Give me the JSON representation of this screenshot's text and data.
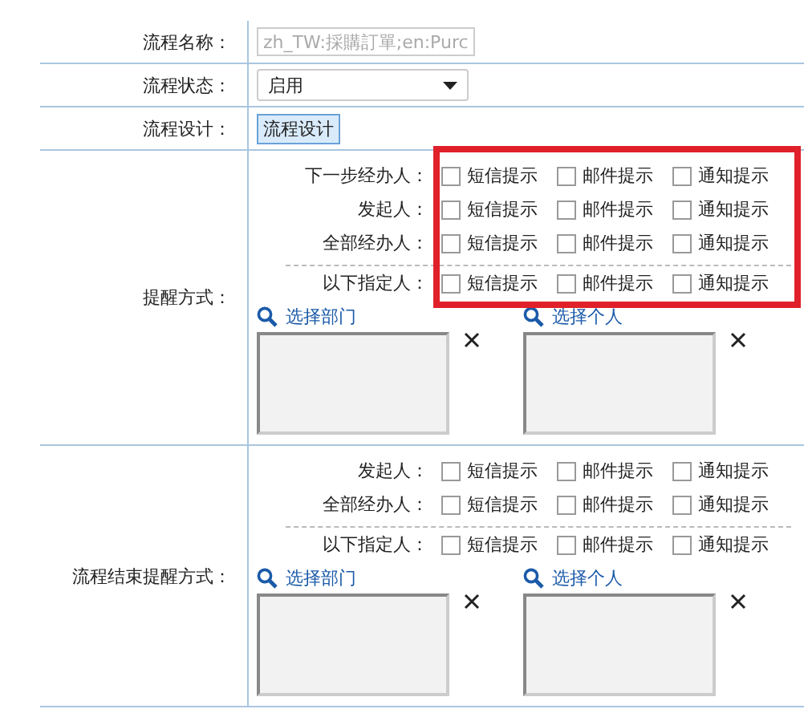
{
  "form": {
    "rows": [
      {
        "kind": "text",
        "label": "流程名称：",
        "value": "zh_TW:採購訂單;en:Purc"
      },
      {
        "kind": "select",
        "label": "流程状态：",
        "value": "启用"
      },
      {
        "kind": "button",
        "label": "流程设计：",
        "value": "流程设计"
      }
    ],
    "sections": [
      {
        "label": "提醒方式：",
        "highlighted": true,
        "recipients": [
          {
            "kind": "plain",
            "label": "下一步经办人：",
            "options": [
              {
                "label": "短信提示",
                "checked": false
              },
              {
                "label": "邮件提示",
                "checked": false
              },
              {
                "label": "通知提示",
                "checked": false
              }
            ]
          },
          {
            "kind": "plain",
            "label": "发起人：",
            "options": [
              {
                "label": "短信提示",
                "checked": false
              },
              {
                "label": "邮件提示",
                "checked": false
              },
              {
                "label": "通知提示",
                "checked": false
              }
            ]
          },
          {
            "kind": "plain",
            "label": "全部经办人：",
            "options": [
              {
                "label": "短信提示",
                "checked": false
              },
              {
                "label": "邮件提示",
                "checked": false
              },
              {
                "label": "通知提示",
                "checked": false
              }
            ]
          },
          {
            "kind": "specified",
            "label": "以下指定人：",
            "options": [
              {
                "label": "短信提示",
                "checked": false
              },
              {
                "label": "邮件提示",
                "checked": false
              },
              {
                "label": "通知提示",
                "checked": false
              }
            ]
          }
        ],
        "pickers": [
          {
            "label": "选择部门"
          },
          {
            "label": "选择个人"
          }
        ]
      },
      {
        "label": "流程结束提醒方式：",
        "highlighted": false,
        "recipients": [
          {
            "kind": "plain",
            "label": "发起人：",
            "options": [
              {
                "label": "短信提示",
                "checked": false
              },
              {
                "label": "邮件提示",
                "checked": false
              },
              {
                "label": "通知提示",
                "checked": false
              }
            ]
          },
          {
            "kind": "plain",
            "label": "全部经办人：",
            "options": [
              {
                "label": "短信提示",
                "checked": false
              },
              {
                "label": "邮件提示",
                "checked": false
              },
              {
                "label": "通知提示",
                "checked": false
              }
            ]
          },
          {
            "kind": "specified",
            "label": "以下指定人：",
            "options": [
              {
                "label": "短信提示",
                "checked": false
              },
              {
                "label": "邮件提示",
                "checked": false
              },
              {
                "label": "通知提示",
                "checked": false
              }
            ]
          }
        ],
        "pickers": [
          {
            "label": "选择部门"
          },
          {
            "label": "选择个人"
          }
        ]
      }
    ]
  }
}
